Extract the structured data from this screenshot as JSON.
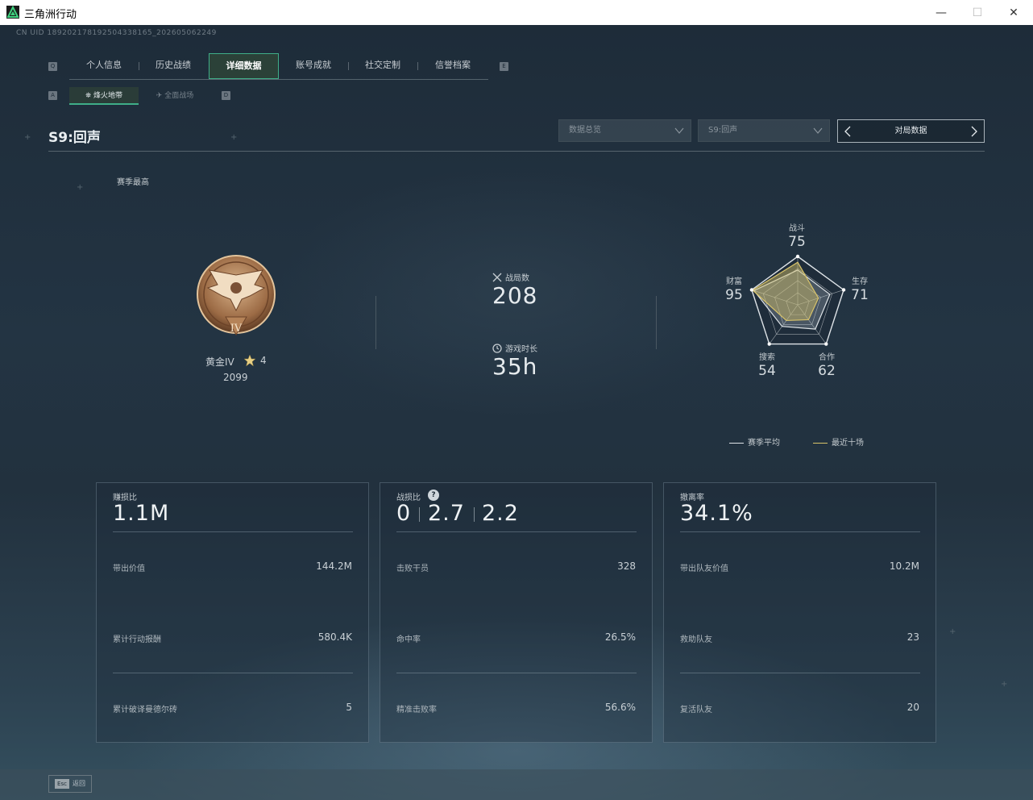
{
  "window": {
    "title": "三角洲行动",
    "min": "—",
    "max": "☐",
    "close": "✕"
  },
  "uid": "CN UID 189202178192504338165_202605062249",
  "main_tabs": {
    "left_key": "Q",
    "right_key": "E",
    "items": [
      "个人信息",
      "历史战绩",
      "详细数据",
      "账号成就",
      "社交定制",
      "信誉档案"
    ],
    "active": "详细数据"
  },
  "sub_tabs": {
    "left_key": "A",
    "right_key": "D",
    "items": [
      "烽火地带",
      "全面战场"
    ],
    "active": "烽火地带"
  },
  "season_title": "S9:回声",
  "filters": {
    "dropdown1": "数据总览",
    "dropdown2": "S9:回声",
    "match_button": "对局数据"
  },
  "season_best": {
    "label": "赛季最高",
    "rank_name": "黄金IV",
    "stars": "4",
    "score": "2099",
    "badge_numeral": "IV"
  },
  "overview": {
    "matches_label": "战局数",
    "matches_value": "208",
    "playtime_label": "游戏时长",
    "playtime_value": "35h"
  },
  "radar": {
    "axes": [
      {
        "label": "战斗",
        "value": "75"
      },
      {
        "label": "生存",
        "value": "71"
      },
      {
        "label": "合作",
        "value": "62"
      },
      {
        "label": "搜索",
        "value": "54"
      },
      {
        "label": "财富",
        "value": "95"
      }
    ],
    "season_avg": [
      0.72,
      0.7,
      0.62,
      0.55,
      0.95
    ],
    "recent_ten": [
      0.88,
      0.45,
      0.38,
      0.4,
      0.98
    ],
    "legend_avg": "赛季平均",
    "legend_recent": "最近十场",
    "color_avg": "#dfe4e8",
    "color_recent": "#d8c36a"
  },
  "cards": [
    {
      "label": "赚损比",
      "big": "1.1M",
      "rows": [
        {
          "label": "带出价值",
          "value": "144.2M"
        },
        {
          "label": "累计行动报酬",
          "value": "580.4K"
        },
        {
          "label": "累计破译曼德尔砖",
          "value": "5"
        }
      ]
    },
    {
      "label": "战损比",
      "help": "?",
      "big_parts": [
        "0",
        "2.7",
        "2.2"
      ],
      "rows": [
        {
          "label": "击败干员",
          "value": "328"
        },
        {
          "label": "命中率",
          "value": "26.5%"
        },
        {
          "label": "精准击败率",
          "value": "56.6%"
        }
      ]
    },
    {
      "label": "撤离率",
      "big": "34.1%",
      "rows": [
        {
          "label": "带出队友价值",
          "value": "10.2M"
        },
        {
          "label": "救助队友",
          "value": "23"
        },
        {
          "label": "复活队友",
          "value": "20"
        }
      ]
    }
  ],
  "footer": {
    "esc_key": "Esc",
    "esc_label": "返回"
  }
}
